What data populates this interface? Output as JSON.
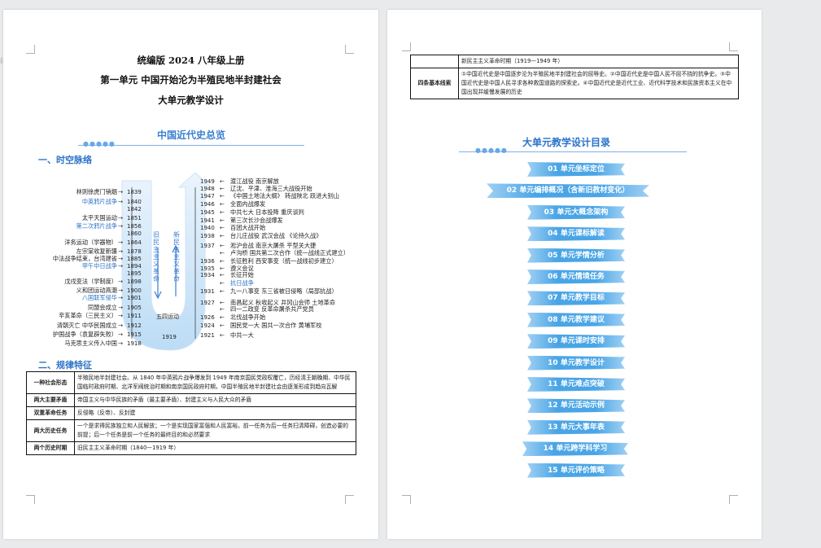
{
  "left": {
    "title1": "统编版 2024 八年级上册",
    "title2": "第一单元  中国开始沦为半殖民地半封建社会",
    "title3": "大单元教学设计",
    "map_title": "中国近代史总览",
    "sec1": "一、时空脉络",
    "sec2": "二、规律特征",
    "left_events": [
      {
        "text": "林则徐虎门销烟",
        "year": "1839",
        "blue": false
      },
      {
        "text": "中英鸦片战争",
        "year": "1840",
        "blue": true
      },
      {
        "text": "",
        "year": "1842",
        "blue": false
      },
      {
        "text": "太平天国运动",
        "year": "1851",
        "blue": false
      },
      {
        "text": "第二次鸦片战争",
        "year": "1856",
        "blue": true
      },
      {
        "text": "",
        "year": "1860",
        "blue": false
      },
      {
        "text": "洋务运动（学器物）",
        "year": "1864",
        "blue": false
      },
      {
        "text": "左宗棠收复新疆",
        "year": "1878",
        "blue": false
      },
      {
        "text": "中法战争结束，台湾建省",
        "year": "1885",
        "blue": false
      },
      {
        "text": "甲午中日战争",
        "year": "1894",
        "blue": true
      },
      {
        "text": "",
        "year": "1895",
        "blue": false
      },
      {
        "text": "戊戌变法（学制度）",
        "year": "1898",
        "blue": false
      },
      {
        "text": "义和团运动高潮",
        "year": "1900",
        "blue": false
      },
      {
        "text": "八国联军侵华",
        "year": "1901",
        "blue": true
      },
      {
        "text": "同盟会成立",
        "year": "1905",
        "blue": false
      },
      {
        "text": "辛亥革命（三民主义）",
        "year": "1911",
        "blue": false
      },
      {
        "text": "清朝灭亡  中华民国成立",
        "year": "1912",
        "blue": false
      },
      {
        "text": "护国战争（袁复辟失败）",
        "year": "1915",
        "blue": false
      },
      {
        "text": "马克思主义传入中国",
        "year": "1918",
        "blue": false
      }
    ],
    "right_events": [
      {
        "year": "1949",
        "text": "渡江战役  南京解放",
        "blue": false
      },
      {
        "year": "1948",
        "text": "辽沈、平津、淮海三大战役开始",
        "blue": false
      },
      {
        "year": "1947",
        "text": "《中国土地法大纲》  转战陕北  跃进大别山",
        "blue": false
      },
      {
        "year": "1946",
        "text": "全面内战爆发",
        "blue": false
      },
      {
        "year": "1945",
        "text": "中共七大  日本投降  重庆谈判",
        "blue": false
      },
      {
        "year": "1941",
        "text": "第三次长沙会战爆发",
        "blue": false
      },
      {
        "year": "1940",
        "text": "百团大战开始",
        "blue": false
      },
      {
        "year": "1938",
        "text": "台儿庄战役  武汉会战  《论持久战》",
        "blue": false
      },
      {
        "year": "1937",
        "text": "淞沪会战  南京大屠杀  平型关大捷",
        "blue": false
      },
      {
        "year": "",
        "text": "卢沟桥  国共第二次合作（统一战线正式建立）",
        "blue": false
      },
      {
        "year": "1936",
        "text": "长征胜利  西安事变（统一战线初步建立）",
        "blue": false
      },
      {
        "year": "1935",
        "text": "遵义会议",
        "blue": false
      },
      {
        "year": "1934",
        "text": "长征开始",
        "blue": false
      },
      {
        "year": "",
        "text": "抗日战争",
        "blue": true
      },
      {
        "year": "1931",
        "text": "九一八事变  东三省被日侵略（局部抗战）",
        "blue": false
      },
      {
        "year": "1927",
        "text": "南昌起义  秋收起义  井冈山会师  土地革命",
        "blue": false
      },
      {
        "year": "",
        "text": "四一二政变  反革命屠杀共产党员",
        "blue": false
      },
      {
        "year": "1926",
        "text": "北伐战争开始",
        "blue": false
      },
      {
        "year": "1924",
        "text": "国民党一大  国共一次合作  黄埔军校",
        "blue": false
      },
      {
        "year": "1921",
        "text": "中共一大",
        "blue": false
      }
    ],
    "old_rev": "旧民主主义革命",
    "new_rev": "新民主主义革命",
    "may4": "五四运动",
    "y1919": "1919",
    "table_rows": [
      {
        "h": "一种社会形态",
        "c": "半殖民地半封建社会。从 1840 年中英鸦片战争爆发到 1949 年南京国民党政权覆亡，历经清王朝晚期、中华民国临时政府时期、北洋军阀统治时期和南京国民政府时期，中国半殖民地半封建社会由逐渐形成到趋向瓦解"
      },
      {
        "h": "两大主要矛盾",
        "c": "帝国主义与中华民族的矛盾（最主要矛盾）、封建主义与人民大众的矛盾"
      },
      {
        "h": "双重革命任务",
        "c": "反侵略（反帝）、反封建"
      },
      {
        "h": "两大历史任务",
        "c": "一个是求得民族独立和人民解放；一个是实现国家富强和人民富裕。前一任务为后一任务扫清障碍，创造必要的前提；后一个任务是前一个任务的最终目的和必然要求"
      },
      {
        "h": "两个历史时期",
        "c": "旧民主主义革命时期（1840—1919 年）"
      }
    ]
  },
  "right": {
    "table_rows": [
      {
        "h": "",
        "c": "新民主主义革命时期（1919—1949 年）"
      },
      {
        "h": "四条基本线索",
        "c": "①中国近代史是中国逐步沦为半殖民地半封建社会的屈辱史。②中国近代史是中国人民不屈不挠的抗争史。③中国近代史是中国人民寻求各种救国道路的探索史。④中国近代史是近代工业、近代科学技术和民族资本主义在中国出现并缓慢发展的历史"
      }
    ],
    "toc_title": "大单元教学设计目录",
    "toc": [
      "01  单元坐标定位",
      "02  单元编排概况（含新旧教材变化）",
      "03  单元大概念架构",
      "04  单元课标解读",
      "05  单元学情分析",
      "06  单元情境任务",
      "07  单元教学目标",
      "08  单元教学建议",
      "09  单元课时安排",
      "10  单元教学设计",
      "11  单元难点突破",
      "12  单元活动示例",
      "13  单元大事年表",
      "14  单元跨学科学习",
      "15  单元评价策略"
    ]
  }
}
